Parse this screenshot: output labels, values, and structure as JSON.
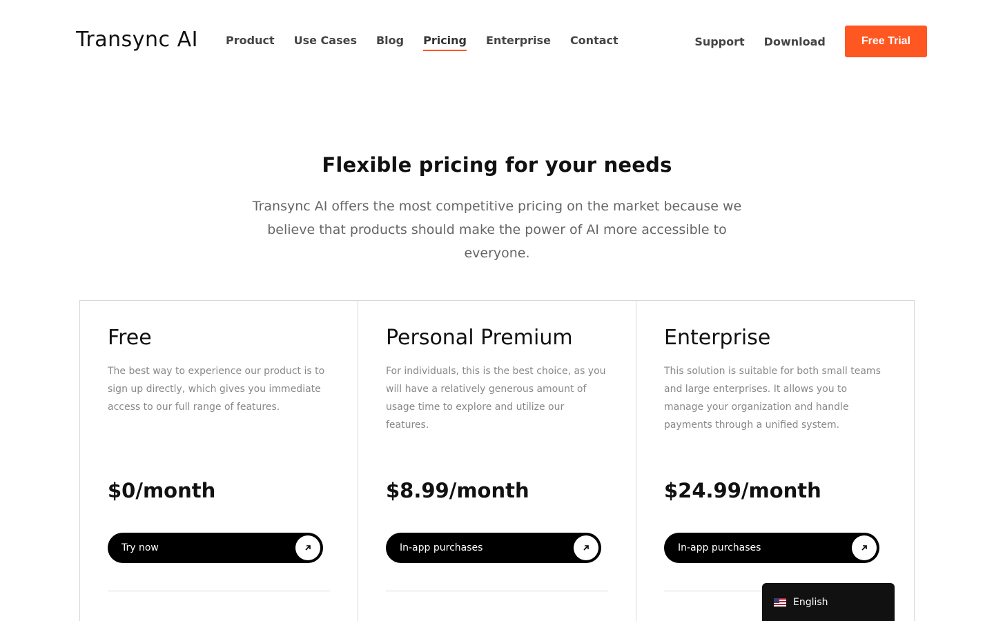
{
  "header": {
    "logo": "Transync AI",
    "nav": [
      {
        "label": "Product"
      },
      {
        "label": "Use Cases"
      },
      {
        "label": "Blog"
      },
      {
        "label": "Pricing",
        "active": true
      },
      {
        "label": "Enterprise"
      },
      {
        "label": "Contact"
      }
    ],
    "support_label": "Support",
    "download_label": "Download",
    "cta_label": "Free Trial"
  },
  "hero": {
    "title": "Flexible pricing for your needs",
    "subtitle": "Transync AI offers the most competitive pricing on the market because we believe that products should make the power of AI more accessible to everyone."
  },
  "plans": [
    {
      "name": "Free",
      "description": "The best way to experience our product is to sign up directly, which gives you immediate access to our full range of features.",
      "price": "$0/month",
      "button_label": "Try now",
      "button_icon": "arrow-up-right-icon"
    },
    {
      "name": "Personal Premium",
      "description": "For individuals, this is the best choice, as you will have a relatively generous amount of usage time to explore and utilize our features.",
      "price": "$8.99/month",
      "button_label": "In-app purchases",
      "button_icon": "arrow-up-right-icon"
    },
    {
      "name": "Enterprise",
      "description": "This solution is suitable for both small teams and large enterprises. It allows you to manage your organization and handle payments through a unified system.",
      "price": "$24.99/month",
      "button_label": "In-app purchases",
      "button_icon": "arrow-up-right-icon"
    }
  ],
  "language": {
    "label": "English",
    "flag_icon": "us-flag-icon"
  },
  "colors": {
    "accent": "#ff5722",
    "button_dark": "#000000",
    "text_muted": "#888888"
  }
}
